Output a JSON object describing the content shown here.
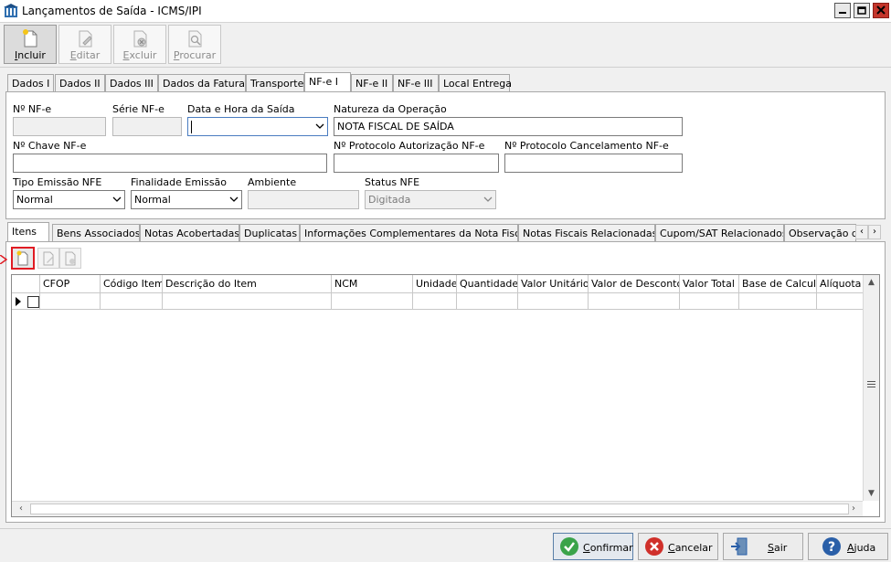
{
  "window": {
    "title": "Lançamentos de Saída - ICMS/IPI"
  },
  "toolbar": {
    "incluir_key": "I",
    "incluir_rest": "ncluir",
    "editar_key": "E",
    "editar_rest": "ditar",
    "excluir_key": "E",
    "excluir_rest": "xcluir",
    "procurar_key": "P",
    "procurar_rest": "rocurar"
  },
  "main_tabs": [
    "Dados I",
    "Dados II",
    "Dados III",
    "Dados da Fatura",
    "Transporte",
    "NF-e I",
    "NF-e II",
    "NF-e III",
    "Local Entrega"
  ],
  "form": {
    "nf_e_label": "Nº NF-e",
    "nf_e_value": "",
    "serie_label": "Série NF-e",
    "serie_value": "",
    "data_hora_label": "Data e Hora da Saída",
    "data_hora_value": "",
    "natureza_label": "Natureza da Operação",
    "natureza_value": "NOTA FISCAL DE SAÍDA",
    "chave_label": "Nº Chave NF-e",
    "chave_value": "",
    "protocolo_aut_label": "Nº Protocolo Autorização NF-e",
    "protocolo_aut_value": "",
    "protocolo_canc_label": "Nº Protocolo Cancelamento NF-e",
    "protocolo_canc_value": "",
    "tipo_emissao_label": "Tipo Emissão NFE",
    "tipo_emissao_value": "Normal",
    "finalidade_label": "Finalidade Emissão",
    "finalidade_value": "Normal",
    "ambiente_label": "Ambiente",
    "ambiente_value": "",
    "status_label": "Status NFE",
    "status_value": "Digitada"
  },
  "sub_tabs": [
    "Itens",
    "Bens Associados",
    "Notas Acobertadas",
    "Duplicatas",
    "Informações Complementares da Nota Fiscal",
    "Notas Fiscais Relacionadas",
    "Cupom/SAT Relacionados",
    "Observação do"
  ],
  "grid": {
    "columns": [
      "CFOP",
      "Código Item",
      "Descrição do Item",
      "NCM",
      "Unidade",
      "Quantidade",
      "Valor Unitário",
      "Valor de Desconto",
      "Valor Total",
      "Base de Calculo",
      "Alíquota"
    ],
    "rows": [
      {
        "cfop": "",
        "codigo": "",
        "descricao": "",
        "ncm": "",
        "unidade": "",
        "quantidade": "",
        "valor_unitario": "",
        "valor_desconto": "",
        "valor_total": "",
        "base_calculo": "",
        "aliquota": ""
      }
    ]
  },
  "footer": {
    "confirmar_key": "C",
    "confirmar_rest": "onfirmar",
    "cancelar_key": "C",
    "cancelar_rest": "ancelar",
    "sair_key": "S",
    "sair_rest": "air",
    "ajuda_key": "A",
    "ajuda_rest": "juda"
  },
  "icons": {
    "app": "building-icon",
    "incluir": "new-document-icon",
    "editar": "edit-document-icon",
    "excluir": "delete-document-icon",
    "procurar": "search-document-icon",
    "confirmar": "check-circle-icon",
    "cancelar": "x-circle-icon",
    "sair": "exit-door-icon",
    "ajuda": "help-circle-icon"
  },
  "colors": {
    "highlight": "#e01b23",
    "confirm_green": "#3aa34a",
    "cancel_red": "#d0302a",
    "help_blue": "#2a5fa8"
  }
}
